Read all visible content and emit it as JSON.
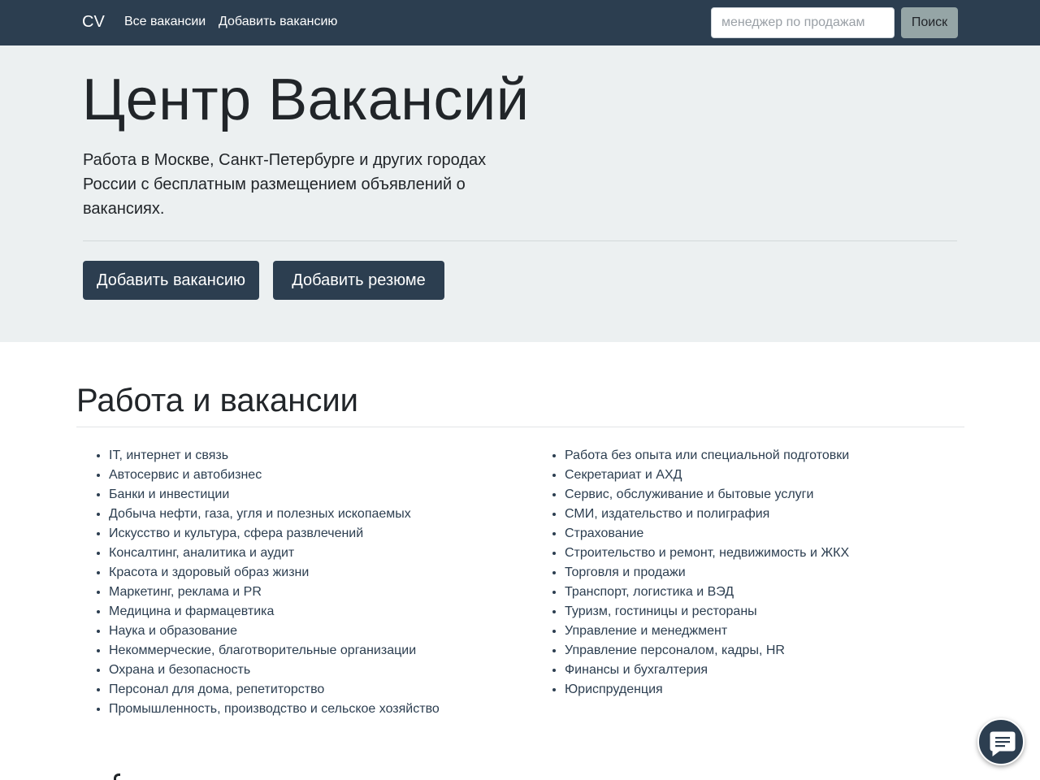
{
  "navbar": {
    "brand": "CV",
    "links": [
      {
        "label": "Все вакансии"
      },
      {
        "label": "Добавить вакансию"
      }
    ],
    "search": {
      "placeholder": "менеджер по продажам",
      "value": "",
      "button_label": "Поиск"
    }
  },
  "hero": {
    "title": "Центр Вакансий",
    "lead": "Работа в Москве, Санкт-Петербурге и других городах России с бесплатным размещением объявлений о вакансиях.",
    "buttons": {
      "add_vacancy": "Добавить вакансию",
      "add_resume": "Добавить резюме"
    }
  },
  "categories": {
    "title": "Работа и вакансии",
    "left": [
      "IT, интернет и связь",
      "Автосервис и автобизнес",
      "Банки и инвестиции",
      "Добыча нефти, газа, угля и полезных ископаемых",
      "Искусство и культура, сфера развлечений",
      "Консалтинг, аналитика и аудит",
      "Красота и здоровый образ жизни",
      "Маркетинг, реклама и PR",
      "Медицина и фармацевтика",
      "Наука и образование",
      "Некоммерческие, благотворительные организации",
      "Охрана и безопасность",
      "Персонал для дома, репетиторство",
      "Промышленность, производство и сельское хозяйство"
    ],
    "right": [
      "Работа без опыта или специальной подготовки",
      "Секретариат и АХД",
      "Сервис, обслуживание и бытовые услуги",
      "СМИ, издательство и полиграфия",
      "Страхование",
      "Строительство и ремонт, недвижимость и ЖКХ",
      "Торговля и продажи",
      "Транспорт, логистика и ВЭД",
      "Туризм, гостиницы и рестораны",
      "Управление и менеджмент",
      "Управление персоналом, кадры, HR",
      "Финансы и бухгалтерия",
      "Юриспруденция"
    ]
  },
  "chat_widget": {
    "icon": "chat-bubble-icon"
  },
  "colors": {
    "navbar_bg": "#2c3e50",
    "jumbotron_bg": "#ecf0f1",
    "primary_button": "#2c3e50",
    "search_button": "#95a5a6",
    "link_text": "#2c3e50"
  }
}
